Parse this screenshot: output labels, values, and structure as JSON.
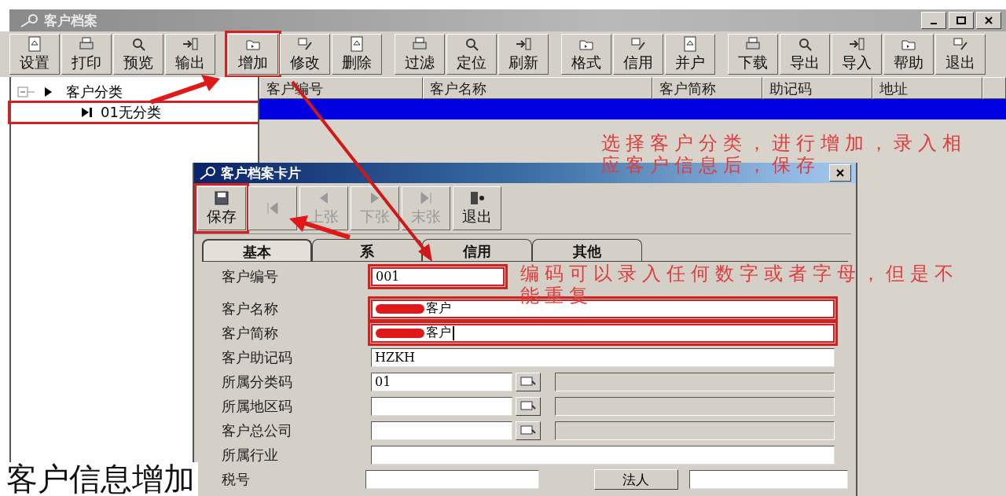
{
  "window": {
    "title": "客户档案"
  },
  "toolbar": [
    {
      "label": "设置",
      "separator_before": false,
      "annotated": false
    },
    {
      "label": "打印",
      "separator_before": false,
      "annotated": false
    },
    {
      "label": "预览",
      "separator_before": false,
      "annotated": false
    },
    {
      "label": "输出",
      "separator_before": false,
      "annotated": false
    },
    {
      "label": "增加",
      "separator_before": true,
      "annotated": true
    },
    {
      "label": "修改",
      "separator_before": false,
      "annotated": false
    },
    {
      "label": "删除",
      "separator_before": false,
      "annotated": false
    },
    {
      "label": "过滤",
      "separator_before": true,
      "annotated": false
    },
    {
      "label": "定位",
      "separator_before": false,
      "annotated": false
    },
    {
      "label": "刷新",
      "separator_before": false,
      "annotated": false
    },
    {
      "label": "格式",
      "separator_before": true,
      "annotated": false
    },
    {
      "label": "信用",
      "separator_before": false,
      "annotated": false
    },
    {
      "label": "并户",
      "separator_before": false,
      "annotated": false
    },
    {
      "label": "下载",
      "separator_before": true,
      "annotated": false
    },
    {
      "label": "导出",
      "separator_before": false,
      "annotated": false
    },
    {
      "label": "导入",
      "separator_before": false,
      "annotated": false
    },
    {
      "label": "帮助",
      "separator_before": false,
      "annotated": false
    },
    {
      "label": "退出",
      "separator_before": false,
      "annotated": false
    }
  ],
  "tree": [
    {
      "label": "客户分类",
      "expanded": true,
      "selected": false,
      "annotated": false,
      "children": [
        {
          "label": "01无分类",
          "selected": true,
          "annotated": true
        }
      ]
    }
  ],
  "grid": {
    "columns": [
      "客户编号",
      "客户名称",
      "客户简称",
      "助记码",
      "地址"
    ],
    "rows": [
      {
        "selected": true
      }
    ]
  },
  "dialog": {
    "title": "客户档案卡片",
    "toolbar": [
      {
        "label": "保存",
        "disabled": false,
        "annotated": true
      },
      {
        "disabled": true,
        "annotated": false
      },
      {
        "label": "上张",
        "disabled": true,
        "annotated": false
      },
      {
        "label": "下张",
        "disabled": true,
        "annotated": false
      },
      {
        "label": "末张",
        "disabled": true,
        "annotated": false
      },
      {
        "label": "退出",
        "disabled": false,
        "annotated": false
      }
    ],
    "tabs": [
      {
        "label": "基本",
        "selected": true
      },
      {
        "label": "系",
        "selected": false
      },
      {
        "label": "信用",
        "selected": false
      },
      {
        "label": "其他",
        "selected": false
      }
    ],
    "fields": [
      {
        "kind": "code",
        "label": "客户编号",
        "value": "001",
        "annotated": true,
        "redacted": false,
        "focused": false
      },
      {
        "kind": "text",
        "label": "客户名称",
        "value": "客户",
        "annotated": true,
        "redacted": true,
        "focused": false
      },
      {
        "kind": "text",
        "label": "客户简称",
        "value": "客户",
        "annotated": true,
        "redacted": true,
        "focused": true
      },
      {
        "kind": "text",
        "label": "客户助记码",
        "value": "HZKH",
        "annotated": false,
        "redacted": false,
        "focused": false
      },
      {
        "kind": "lookup",
        "label": "所属分类码",
        "value": "01",
        "annotated": false,
        "redacted": false,
        "focused": false
      },
      {
        "kind": "lookup",
        "label": "所属地区码",
        "annotated": false,
        "redacted": false,
        "focused": false
      },
      {
        "kind": "lookup",
        "label": "客户总公司",
        "annotated": false,
        "redacted": false,
        "focused": false
      },
      {
        "kind": "text",
        "label": "所属行业",
        "annotated": false,
        "redacted": false,
        "focused": false
      },
      {
        "kind": "button",
        "label": "税号",
        "button": "法人",
        "annotated": false,
        "redacted": false,
        "focused": false
      }
    ]
  },
  "notes": [
    {
      "lines": [
        "选择客户分类，进行增加，录入相",
        "应客户信息后，保存"
      ]
    },
    {
      "lines": [
        "编码可以录入任何数字或者字母，但是不",
        "能重复"
      ]
    }
  ],
  "caption": "客户信息增加"
}
